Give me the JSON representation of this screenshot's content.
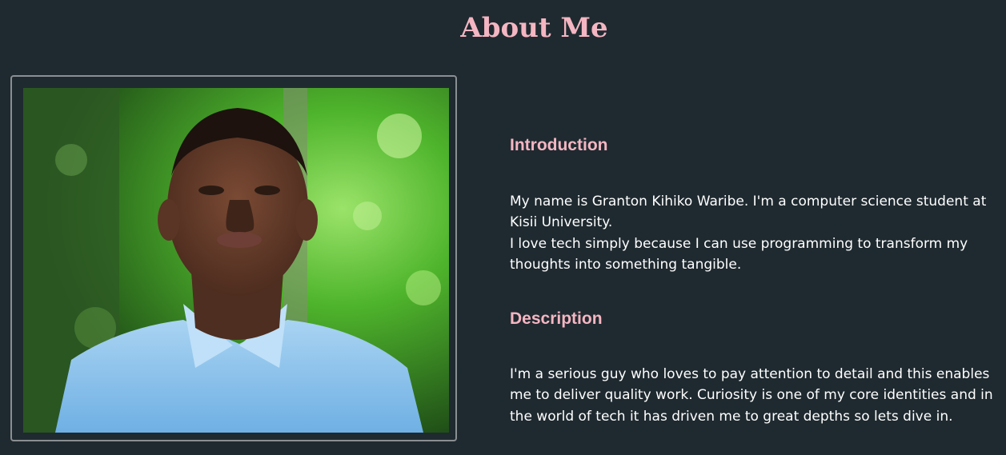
{
  "page": {
    "title": "About Me",
    "colors": {
      "background": "#1f2a30",
      "accent": "#f4b6c2",
      "text": "#ffffff",
      "frame_border": "#8a8f92"
    }
  },
  "photo": {
    "alt": "Portrait of Granton Kihiko Waribe"
  },
  "introduction": {
    "heading": "Introduction",
    "lines": [
      "My name is Granton Kihiko Waribe. I'm a computer science student at Kisii University.",
      "I love tech simply because I can use programming to transform my thoughts into something tangible."
    ]
  },
  "description": {
    "heading": "Description",
    "text": "I'm a serious guy who loves to pay attention to detail and this enables me to deliver quality work. Curiosity is one of my core identities and in the world of tech it has driven me to great depths so lets dive in."
  }
}
